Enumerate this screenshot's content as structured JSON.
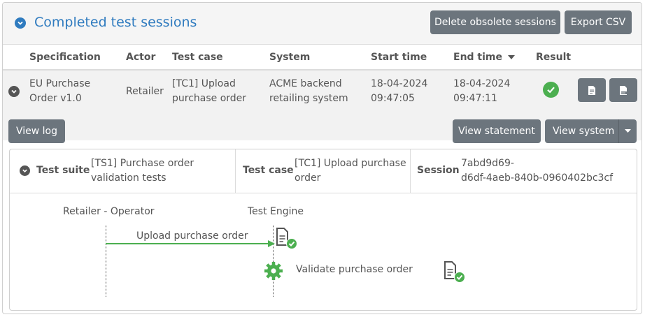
{
  "header": {
    "title": "Completed test sessions",
    "delete_label": "Delete obsolete sessions",
    "export_label": "Export CSV"
  },
  "columns": {
    "specification": "Specification",
    "actor": "Actor",
    "test_case": "Test case",
    "system": "System",
    "start_time": "Start time",
    "end_time": "End time",
    "result": "Result"
  },
  "session_row": {
    "specification_line1": "EU Purchase",
    "specification_line2": "Order v1.0",
    "actor": "Retailer",
    "test_case_line1": "[TC1] Upload",
    "test_case_line2": "purchase order",
    "system_line1": "ACME backend",
    "system_line2": "retailing system",
    "start_date": "18-04-2024",
    "start_time": "09:47:05",
    "end_date": "18-04-2024",
    "end_time": "09:47:11",
    "result": "success"
  },
  "actions": {
    "view_log": "View log",
    "view_statement": "View statement",
    "view_system": "View system"
  },
  "details": {
    "suite_label": "Test suite",
    "suite_line1": "[TS1] Purchase order",
    "suite_line2": "validation tests",
    "case_label": "Test case",
    "case_line1": "[TC1] Upload purchase",
    "case_line2": "order",
    "session_label": "Session",
    "session_line1": "7abd9d69-",
    "session_line2": "d6df-4aeb-840b-0960402bc3cf"
  },
  "diagram": {
    "lane_operator": "Retailer - Operator",
    "lane_engine": "Test Engine",
    "step_upload": "Upload purchase order",
    "step_validate": "Validate purchase order"
  },
  "colors": {
    "accent": "#2f7bbf",
    "button": "#6c757d",
    "success": "#4caf50"
  }
}
